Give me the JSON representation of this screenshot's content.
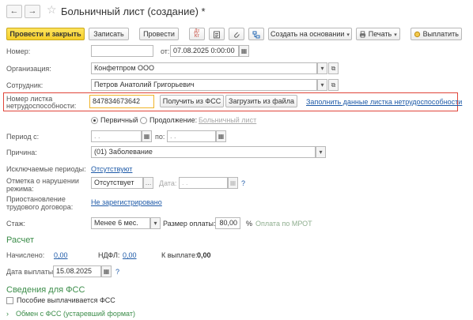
{
  "window": {
    "title": "Больничный лист (создание) *",
    "back_icon": "←",
    "forward_icon": "→",
    "star_icon": "☆"
  },
  "toolbar": {
    "post_close": "Провести и закрыть",
    "save": "Записать",
    "post": "Провести",
    "create_based": "Создать на основании",
    "print": "Печать",
    "pay": "Выплатить"
  },
  "form": {
    "number_label": "Номер:",
    "number_value": "",
    "date_label": "от:",
    "date_value": "07.08.2025  0:00:00",
    "org_label": "Организация:",
    "org_value": "Конфетпром ООО",
    "employee_label": "Сотрудник:",
    "employee_value": "Петров Анатолий Григорьевич",
    "sick_number_label_1": "Номер листка",
    "sick_number_label_2": "нетрудоспособности:",
    "sick_number_value": "847834673642",
    "get_fss_button": "Получить из ФСС",
    "load_file_button": "Загрузить из файла",
    "fill_link": "Заполнить данные листка нетрудоспособности",
    "primary_option": "Первичный",
    "continuation_option": "Продолжение:",
    "sick_leave_link": "Больничный лист",
    "period_label": "Период с:",
    "period_from": " .  .",
    "period_to_label": "по:",
    "period_to": " .  .",
    "reason_label": "Причина:",
    "reason_value": "(01) Заболевание",
    "excluded_label": "Исключаемые периоды:",
    "excluded_link": "Отсутствуют",
    "violation_label_1": "Отметка о нарушении",
    "violation_label_2": "режима:",
    "violation_value": "Отсутствует",
    "violation_date_label": "Дата:",
    "violation_date_value": " .  .",
    "suspension_label_1": "Приостановление",
    "suspension_label_2": "трудового договора:",
    "suspension_link": "Не зарегистрировано",
    "experience_label": "Стаж:",
    "experience_value": "Менее 6 мес.",
    "pay_size_label": "Размер оплаты:",
    "pay_size_value": "80,00",
    "percent": "%",
    "mrot_note": "Оплата по МРОТ",
    "help": "?"
  },
  "calc": {
    "section_title": "Расчет",
    "accrued_label": "Начислено:",
    "accrued_value": "0,00",
    "ndfl_label": "НДФЛ:",
    "ndfl_value": "0,00",
    "to_pay_label": "К выплате:",
    "to_pay_value": "0,00",
    "pay_date_label": "Дата выплаты:",
    "pay_date_value": "15.08.2025"
  },
  "fss": {
    "section_title": "Сведения для ФСС",
    "benefit_checkbox": "Пособие выплачивается ФСС",
    "exchange_link": "Обмен с ФСС (устаревший формат)"
  },
  "colors": {
    "primary_button": "#f5cf2a",
    "highlight_border": "#e0453a",
    "focus_border": "#f0b429",
    "link": "#1e5aa8",
    "section": "#3c8d4a"
  }
}
